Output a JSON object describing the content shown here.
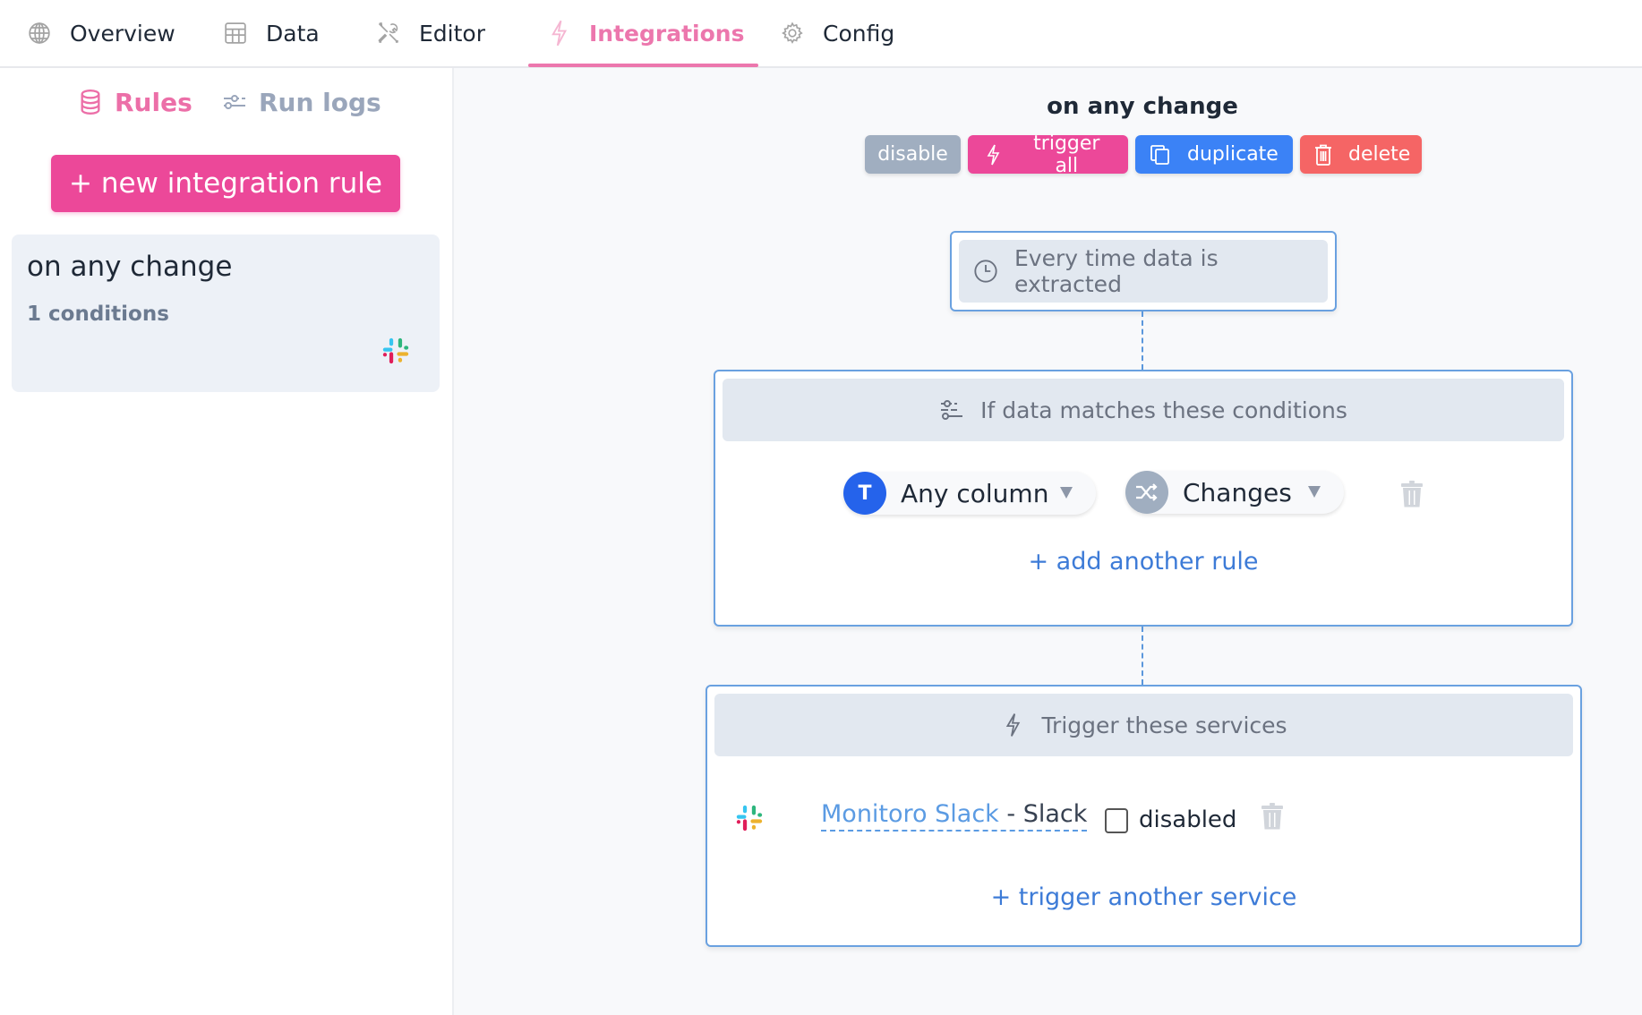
{
  "nav": {
    "tabs": [
      {
        "label": "Overview",
        "icon": "globe-icon",
        "active": false
      },
      {
        "label": "Data",
        "icon": "table-icon",
        "active": false
      },
      {
        "label": "Editor",
        "icon": "tools-icon",
        "active": false
      },
      {
        "label": "Integrations",
        "icon": "lightning-icon",
        "active": true
      },
      {
        "label": "Config",
        "icon": "gear-icon",
        "active": false
      }
    ]
  },
  "sidebar": {
    "subtabs": [
      {
        "label": "Rules",
        "icon": "database-icon",
        "active": true
      },
      {
        "label": "Run logs",
        "icon": "sliders-icon",
        "active": false
      }
    ],
    "new_rule_label": "+ new integration rule",
    "rules": [
      {
        "name": "on any change",
        "conditions": "1 conditions",
        "service_icon": "slack-icon"
      }
    ]
  },
  "rule": {
    "title": "on any change",
    "actions": {
      "disable": "disable",
      "trigger_all": "trigger all",
      "duplicate": "duplicate",
      "delete": "delete"
    },
    "trigger": {
      "label": "Every time data is extracted",
      "icon": "clock-icon"
    },
    "conditions": {
      "header": "If data matches these conditions",
      "items": [
        {
          "column": "Any column",
          "column_badge": "T",
          "operator": "Changes",
          "operator_icon": "shuffle-icon"
        }
      ],
      "add_label": "+ add another rule"
    },
    "services": {
      "header": "Trigger these services",
      "items": [
        {
          "name": "Monitoro Slack",
          "type": " - Slack",
          "disabled_label": "disabled",
          "disabled": false,
          "icon": "slack-icon"
        }
      ],
      "add_label": "+ trigger another service"
    }
  },
  "colors": {
    "accent_pink": "#ec4899",
    "active_tab": "#ec77ad",
    "link_blue": "#3d7bd7",
    "box_border": "#6aa1e0",
    "disable_gray": "#a0aec0",
    "duplicate_blue": "#3b82f6",
    "delete_red": "#f56565"
  }
}
